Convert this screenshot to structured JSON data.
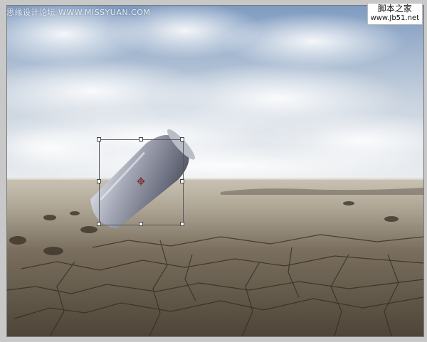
{
  "watermark": {
    "site_left": "思缘设计论坛 WWW.MISSYUAN.COM",
    "site_right_name": "脚本之家",
    "site_right_url": "www.Jb51.net"
  },
  "colors": {
    "sky": "#8fa9c8",
    "cloud": "#f2f4f6",
    "ground_far": "#b9b3a5",
    "ground_near": "#5b5244",
    "object": "#8e93a4",
    "transform_box": "#555555"
  }
}
